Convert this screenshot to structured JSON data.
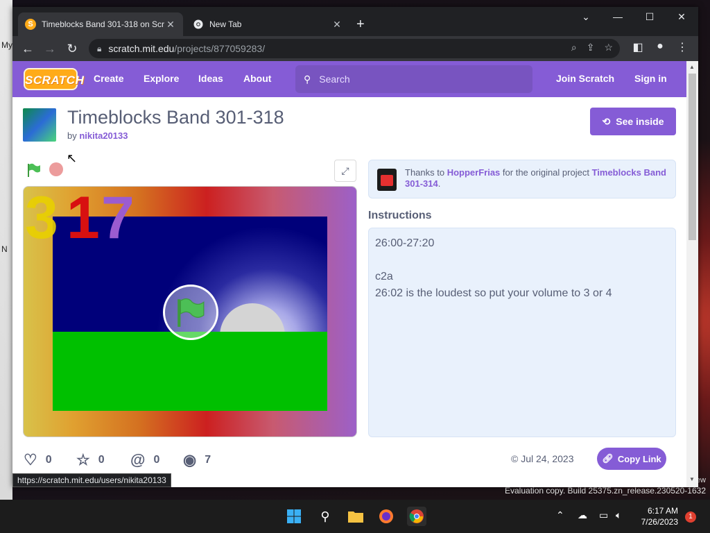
{
  "desktop": {
    "left_labels": [
      "My",
      "N"
    ],
    "right_text": "ew",
    "watermark": "Evaluation copy. Build 25375.zn_release.230520-1632"
  },
  "browser": {
    "tabs": [
      {
        "title": "Timeblocks Band 301-318 on Scr",
        "favicon": "scratch-icon"
      },
      {
        "title": "New Tab",
        "favicon": "chrome-icon"
      }
    ],
    "url_host": "scratch.mit.edu",
    "url_path": "/projects/877059283/",
    "status_url": "https://scratch.mit.edu/users/nikita20133"
  },
  "scratch_nav": {
    "logo": "SCRATCH",
    "links": [
      "Create",
      "Explore",
      "Ideas",
      "About"
    ],
    "search_placeholder": "Search",
    "join": "Join Scratch",
    "signin": "Sign in"
  },
  "project": {
    "title": "Timeblocks Band 301-318",
    "by_prefix": "by",
    "author": "nikita20133",
    "see_inside": "See inside",
    "stage_numbers": [
      "3",
      "1",
      "7"
    ],
    "credit": {
      "prefix": "Thanks to",
      "user": "HopperFrias",
      "middle": "for the original project",
      "project": "Timeblocks Band 301-314",
      "suffix": "."
    },
    "instructions_heading": "Instructions",
    "instructions": [
      "26:00-27:20",
      "",
      "c2a",
      "26:02 is the loudest so put your volume to 3 or 4"
    ],
    "stats": {
      "loves": "0",
      "favorites": "0",
      "remixes": "0",
      "views": "7"
    },
    "date": "© Jul 24, 2023",
    "copy_link": "Copy Link"
  },
  "taskbar": {
    "time": "6:17 AM",
    "date": "7/26/2023",
    "notification_count": "1"
  },
  "colors": {
    "scratch_purple": "#855cd6",
    "text_gray": "#575e75",
    "panel_blue": "#e9f1fc"
  }
}
